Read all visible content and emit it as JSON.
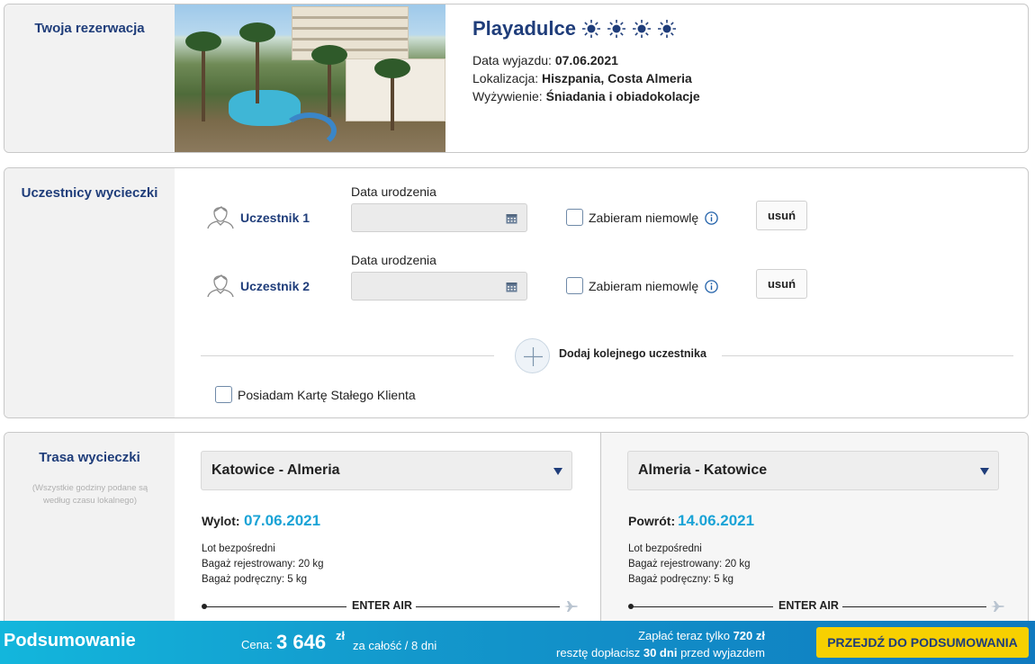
{
  "reservation": {
    "section_title": "Twoja rezerwacja",
    "hotel_name": "Playadulce",
    "stars": 4,
    "star_icon": "sun-icon",
    "departure_label": "Data wyjazdu:",
    "departure_value": "07.06.2021",
    "location_label": "Lokalizacja:",
    "location_value": "Hiszpania, Costa Almeria",
    "board_label": "Wyżywienie:",
    "board_value": "Śniadania i obiadokolacje"
  },
  "participants": {
    "section_title": "Uczestnicy wycieczki",
    "items": [
      {
        "label": "Uczestnik 1",
        "dob_label": "Data urodzenia",
        "infant_label": "Zabieram niemowlę",
        "remove_label": "usuń"
      },
      {
        "label": "Uczestnik 2",
        "dob_label": "Data urodzenia",
        "infant_label": "Zabieram niemowlę",
        "remove_label": "usuń"
      }
    ],
    "add_label": "Dodaj kolejnego uczestnika",
    "loyalty_label": "Posiadam Kartę Stałego Klienta"
  },
  "route": {
    "section_title": "Trasa wycieczki",
    "note": "(Wszystkie godziny podane są według czasu lokalnego)",
    "outbound": {
      "route": "Katowice - Almeria",
      "date_label": "Wylot:",
      "date": "07.06.2021",
      "details": [
        "Lot bezpośredni",
        "Bagaż rejestrowany: 20 kg",
        "Bagaż podręczny: 5 kg"
      ],
      "carrier": "ENTER AIR"
    },
    "inbound": {
      "route": "Almeria - Katowice",
      "date_label": "Powrót:",
      "date": "14.06.2021",
      "details": [
        "Lot bezpośredni",
        "Bagaż rejestrowany: 20 kg",
        "Bagaż podręczny: 5 kg"
      ],
      "carrier": "ENTER AIR"
    }
  },
  "summary": {
    "title": "Podsumowanie",
    "price_label": "Cena:",
    "price": "3 646",
    "currency": "zł",
    "price_note": "za całość / 8 dni",
    "pay_now_prefix": "Zapłać teraz tylko",
    "pay_now_amount": "720 zł",
    "pay_rest_prefix": "resztę dopłacisz",
    "pay_rest_days": "30 dni",
    "pay_rest_suffix": "przed wyjazdem",
    "cta_label": "PRZEJDŹ DO PODSUMOWANIA"
  },
  "colors": {
    "brand_navy": "#1f3d7a",
    "accent_cyan": "#1aa3d6",
    "cta_yellow": "#f7d000"
  }
}
